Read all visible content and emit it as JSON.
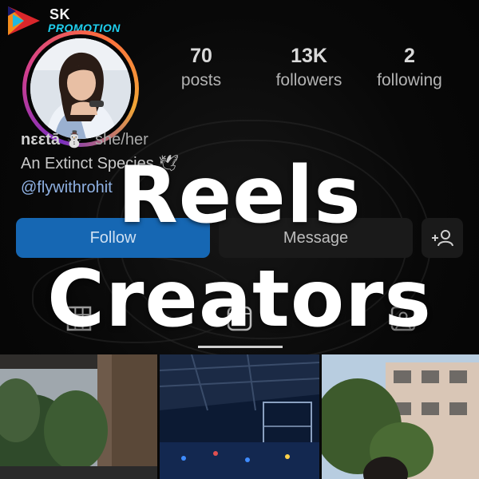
{
  "logo": {
    "line1": "SK",
    "line2": "PROMOTION"
  },
  "profile": {
    "stats": [
      {
        "value": "70",
        "label": "posts"
      },
      {
        "value": "13K",
        "label": "followers"
      },
      {
        "value": "2",
        "label": "following"
      }
    ],
    "name": "nεεtā",
    "name_emoji": "⛄",
    "pronouns": "she/her",
    "bio_line": "An Extinct Species",
    "bio_emoji": "🕊",
    "handle": "@flywithrohit"
  },
  "actions": {
    "follow_label": "Follow",
    "message_label": "Message",
    "add_icon": "add-person-icon"
  },
  "tabs": [
    {
      "icon": "grid-icon"
    },
    {
      "icon": "reels-icon"
    },
    {
      "icon": "tagged-icon"
    }
  ],
  "overlay": {
    "line1": "Reels",
    "line2": "Creators"
  },
  "colors": {
    "follow_bg": "#1667b3",
    "ring_gradient": [
      "#7b2fbf",
      "#d33f8c",
      "#ff6b3d",
      "#f1a636"
    ],
    "accent_cyan": "#1fd0ef"
  }
}
